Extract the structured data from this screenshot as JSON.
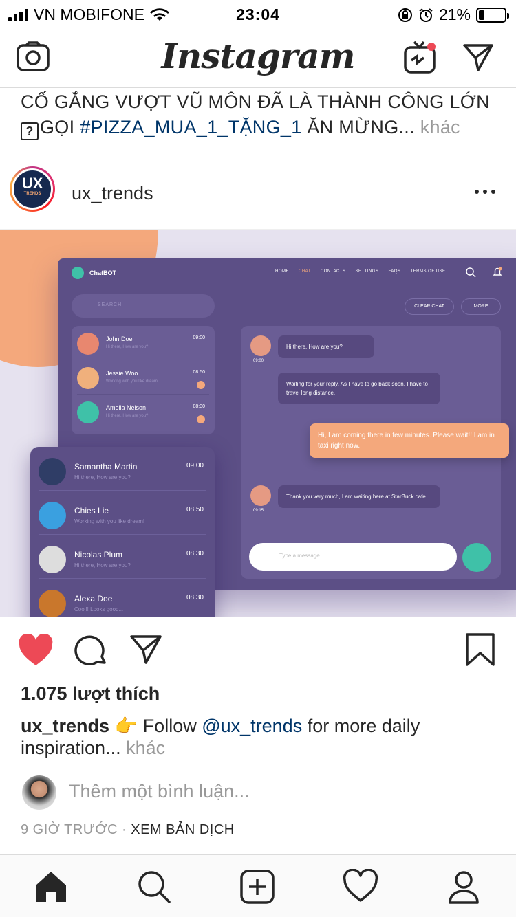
{
  "status_bar": {
    "carrier": "VN MOBIFONE",
    "time": "23:04",
    "battery": "21%",
    "battery_level": 0.21
  },
  "topbar": {
    "logo": "Instagram"
  },
  "prev_caption": {
    "text_before": "CỐ GẮNG VƯỢT VŨ MÔN ĐÃ LÀ THÀNH CÔNG LỚN ",
    "emoji": "?",
    "text_goi": "GỌI ",
    "hashtag": "#PIZZA_MUA_1_TẶNG_1",
    "text_after": " ĂN MỪNG...",
    "more": "khác"
  },
  "post": {
    "username": "ux_trends",
    "avatar_text": "UX",
    "avatar_sub": "TRENDS",
    "likes": "1.075 lượt thích",
    "caption_user": "ux_trends",
    "caption_emoji": "👉",
    "caption_follow": " Follow ",
    "caption_mention": "@ux_trends",
    "caption_rest": " for more daily inspiration...",
    "caption_more": "khác",
    "comment_placeholder": "Thêm một bình luận...",
    "time_ago": "9 GIỜ TRƯỚC",
    "separator": "·",
    "translate": "XEM BẢN DỊCH"
  },
  "image": {
    "brand": "ChatBOT",
    "nav": [
      "HOME",
      "CHAT",
      "CONTACTS",
      "SETTINGS",
      "FAQS",
      "TERMS OF USE"
    ],
    "search_placeholder": "SEARCH",
    "clear_chat": "CLEAR CHAT",
    "more": "MORE",
    "contacts_small": [
      {
        "name": "John Doe",
        "snippet": "Hi there, How are you?",
        "time": "09:00",
        "badge": ""
      },
      {
        "name": "Jessie Woo",
        "snippet": "Working with you like dream!",
        "time": "08:50",
        "badge": "5"
      },
      {
        "name": "Amelia Nelson",
        "snippet": "Hi there, How are you?",
        "time": "08:30",
        "badge": "6"
      }
    ],
    "contacts_big": [
      {
        "name": "Samantha Martin",
        "snippet": "Hi there, How are you?",
        "time": "09:00"
      },
      {
        "name": "Chies Lie",
        "snippet": "Working with you like dream!",
        "time": "08:50"
      },
      {
        "name": "Nicolas Plum",
        "snippet": "Hi there, How are you?",
        "time": "08:30"
      },
      {
        "name": "Alexa Doe",
        "snippet": "Cool!! Looks good...",
        "time": "08:30"
      }
    ],
    "messages": [
      {
        "text": "Hi there, How are you?",
        "time": "09:00"
      },
      {
        "text": "Waiting for your reply. As I have to go back soon. I have to travel long distance."
      },
      {
        "text": "Hi, I am coming there in few minutes. Please wait!! I am in taxi right now."
      },
      {
        "text": "Thank you very much, I am waiting here at StarBuck cafe.",
        "time": "09:15"
      }
    ],
    "input_placeholder": "Type a message"
  },
  "colors": {
    "like_red": "#ed4956",
    "link_blue": "#003569",
    "app_purple": "#5c4f86",
    "accent_orange": "#f4a87c",
    "teal": "#3fc1a8"
  }
}
